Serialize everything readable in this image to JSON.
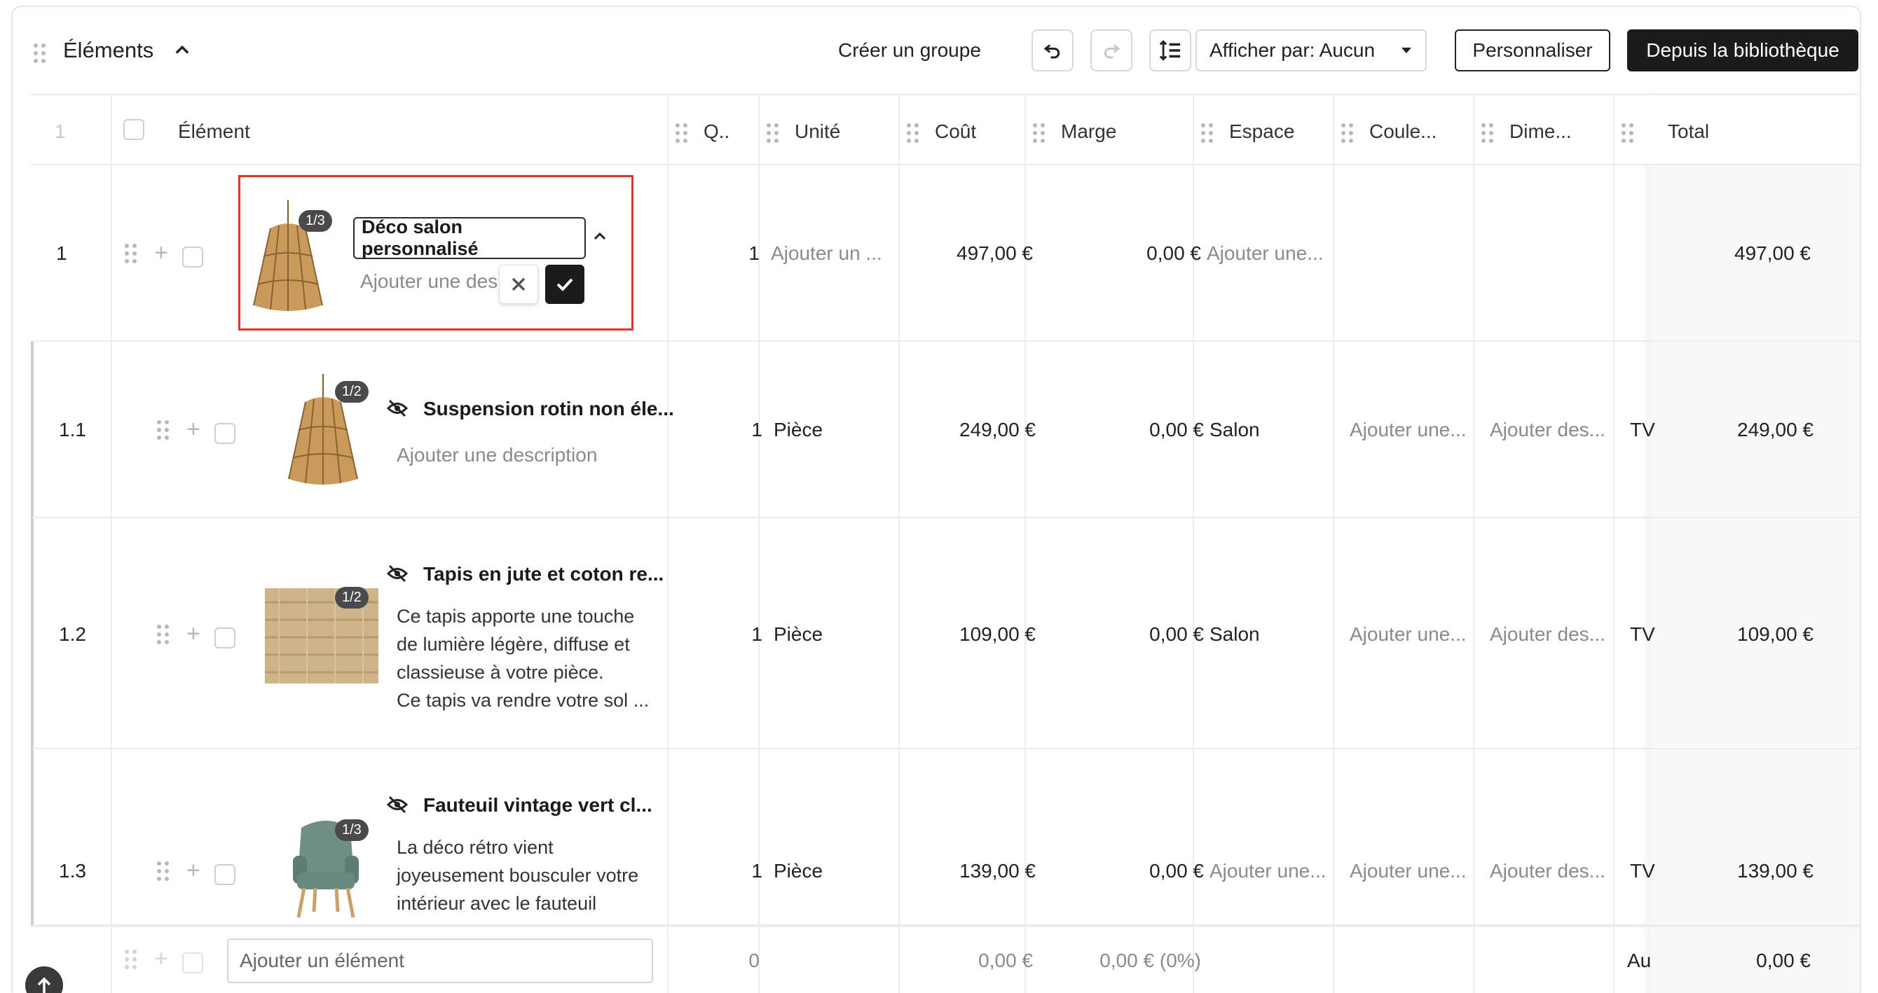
{
  "toolbar": {
    "title": "Éléments",
    "create_group": "Créer un groupe",
    "display_by": "Afficher par: Aucun",
    "customize": "Personnaliser",
    "from_library": "Depuis la bibliothèque"
  },
  "columns": {
    "index": "1",
    "element": "Élément",
    "qty": "Q..",
    "unit": "Unité",
    "cost": "Coût",
    "margin": "Marge",
    "space": "Espace",
    "color": "Coule...",
    "dimension": "Dime...",
    "total": "Total"
  },
  "rows": [
    {
      "num": "1",
      "badge": "1/3",
      "name_input": "Déco salon personnalisé",
      "desc_placeholder": "Ajouter une des",
      "qty": "1",
      "unit": "Ajouter un ...",
      "cost": "497,00 €",
      "margin": "0,00 €",
      "space": "Ajouter une...",
      "total": "497,00 €"
    },
    {
      "num": "1.1",
      "badge": "1/2",
      "name": "Suspension rotin non éle...",
      "desc": "Ajouter une description",
      "qty": "1",
      "unit": "Pièce",
      "cost": "249,00 €",
      "margin": "0,00 €",
      "space": "Salon",
      "color": "Ajouter une...",
      "dimension": "Ajouter des...",
      "extra": "TV",
      "total": "249,00 €"
    },
    {
      "num": "1.2",
      "badge": "1/2",
      "name": "Tapis en jute et coton re...",
      "desc_lines": [
        "Ce tapis apporte une touche",
        "de lumière légère, diffuse et",
        "classieuse à votre pièce.",
        "Ce tapis va rendre votre sol ..."
      ],
      "qty": "1",
      "unit": "Pièce",
      "cost": "109,00 €",
      "margin": "0,00 €",
      "space": "Salon",
      "color": "Ajouter une...",
      "dimension": "Ajouter des...",
      "extra": "TV",
      "total": "109,00 €"
    },
    {
      "num": "1.3",
      "badge": "1/3",
      "name": "Fauteuil vintage vert cl...",
      "desc_lines": [
        "La déco rétro vient",
        "joyeusement bousculer votre",
        "intérieur avec le fauteuil"
      ],
      "qty": "1",
      "unit": "Pièce",
      "cost": "139,00 €",
      "margin": "0,00 €",
      "space": "Ajouter une...",
      "color": "Ajouter une...",
      "dimension": "Ajouter des...",
      "extra": "TV",
      "total": "139,00 €"
    }
  ],
  "footer": {
    "add_placeholder": "Ajouter un élément",
    "qty": "0",
    "cost": "0,00 €",
    "margin": "0,00 € (0%)",
    "extra": "Au",
    "total": "0,00 €"
  },
  "colors": {
    "accent_dark": "#1b1b1b",
    "highlight_red": "#e0332b"
  }
}
